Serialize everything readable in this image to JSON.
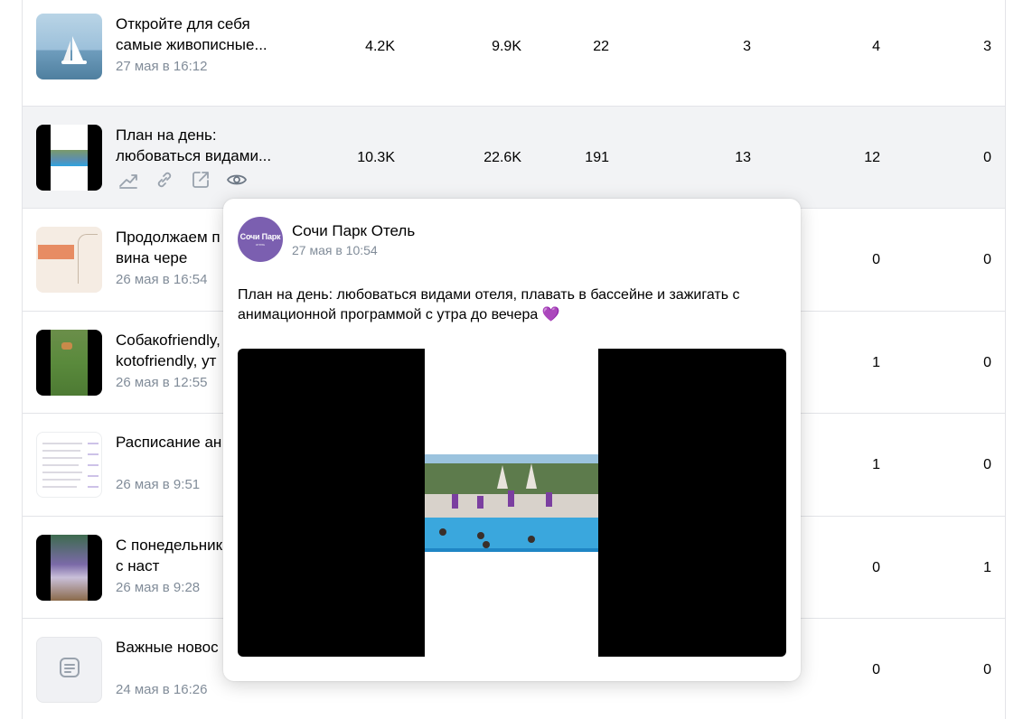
{
  "posts": [
    {
      "title": "Откройте для себя самые живописные...",
      "date": "27 мая в 16:12",
      "v1": "4.2K",
      "v2": "9.9K",
      "v3": "22",
      "v4": "3",
      "v5": "4",
      "v6": "3"
    },
    {
      "title": "План на день: любоваться видами...",
      "date": "",
      "v1": "10.3K",
      "v2": "22.6K",
      "v3": "191",
      "v4": "13",
      "v5": "12",
      "v6": "0"
    },
    {
      "title": "Продолжаем п мир вина чере",
      "date": "26 мая в 16:54",
      "v5": "0",
      "v6": "0"
    },
    {
      "title": "Собакоfriendly, kotofriendly, ут",
      "date": "26 мая в 12:55",
      "v5": "1",
      "v6": "0"
    },
    {
      "title": "Расписание ан мае 💜",
      "date": "26 мая в 9:51",
      "v5": "1",
      "v6": "0"
    },
    {
      "title": "С понедельник сегодня с наст",
      "date": "26 мая в 9:28",
      "v5": "0",
      "v6": "1"
    },
    {
      "title": "Важные новос",
      "date": "24 мая в 16:26",
      "v5": "0",
      "v6": "0"
    }
  ],
  "icons": [
    "stats-icon",
    "link-icon",
    "external-link-icon",
    "eye-icon",
    "document-icon"
  ],
  "popup": {
    "avatar_text": "Сочи Парк",
    "avatar_subtext": "отель",
    "author": "Сочи Парк Отель",
    "date": "27 мая в 10:54",
    "text": "План на день: любоваться видами отеля, плавать в бассейне и зажигать с анимационной программой с утра до вечера 💜"
  },
  "colors": {
    "accent": "#7b5fb0",
    "secondary_text": "#818c99",
    "hover_row": "#f2f3f5",
    "border": "#e3e4e8"
  }
}
